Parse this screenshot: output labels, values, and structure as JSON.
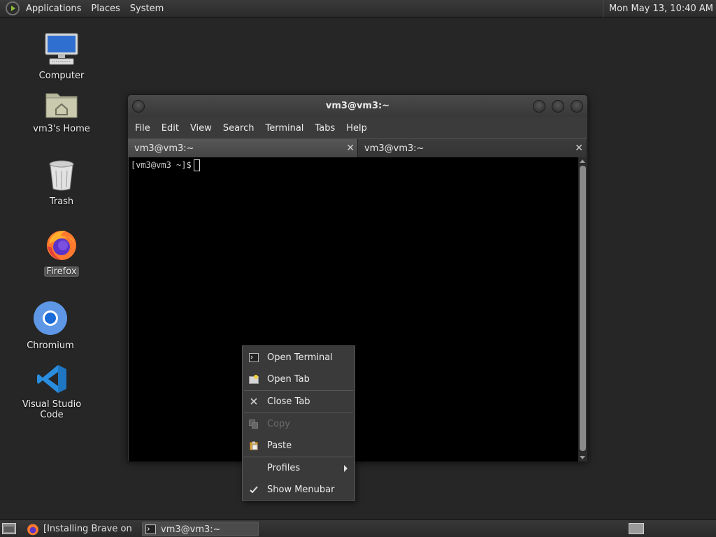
{
  "top_panel": {
    "menus": [
      "Applications",
      "Places",
      "System"
    ],
    "clock": "Mon May 13, 10:40 AM"
  },
  "desktop": {
    "icons": [
      {
        "label": "Computer",
        "icon": "computer-icon"
      },
      {
        "label": "vm3's Home",
        "icon": "home-folder-icon"
      },
      {
        "label": "Trash",
        "icon": "trash-icon"
      },
      {
        "label": "Firefox",
        "icon": "firefox-icon",
        "selected": true
      },
      {
        "label": "Chromium",
        "icon": "chromium-icon"
      },
      {
        "label": "Visual Studio Code",
        "icon": "vscode-icon"
      }
    ]
  },
  "terminal": {
    "title": "vm3@vm3:~",
    "menubar": [
      "File",
      "Edit",
      "View",
      "Search",
      "Terminal",
      "Tabs",
      "Help"
    ],
    "tabs": [
      {
        "label": "vm3@vm3:~",
        "active": true
      },
      {
        "label": "vm3@vm3:~",
        "active": false
      }
    ],
    "prompt": "[vm3@vm3 ~]$",
    "tab_close_glyph": "✕"
  },
  "context_menu": {
    "items": [
      {
        "label": "Open Terminal",
        "icon": "terminal-icon"
      },
      {
        "label": "Open Tab",
        "icon": "new-tab-icon"
      },
      {
        "label": "Close Tab",
        "icon": "close-icon"
      },
      {
        "label": "Copy",
        "icon": "copy-icon",
        "disabled": true
      },
      {
        "label": "Paste",
        "icon": "paste-icon"
      },
      {
        "label": "Profiles",
        "submenu": true
      },
      {
        "label": "Show Menubar",
        "icon": "check-icon",
        "checked": true
      }
    ]
  },
  "taskbar": {
    "tasks": [
      {
        "label": "[Installing Brave on ...",
        "icon": "firefox-icon"
      },
      {
        "label": "vm3@vm3:~",
        "icon": "terminal-icon",
        "active": true
      }
    ]
  },
  "colors": {
    "desktop_bg": "#262626",
    "panel_bg": "#333333",
    "terminal_bg": "#000000",
    "menu_bg": "#3a3a3a"
  }
}
